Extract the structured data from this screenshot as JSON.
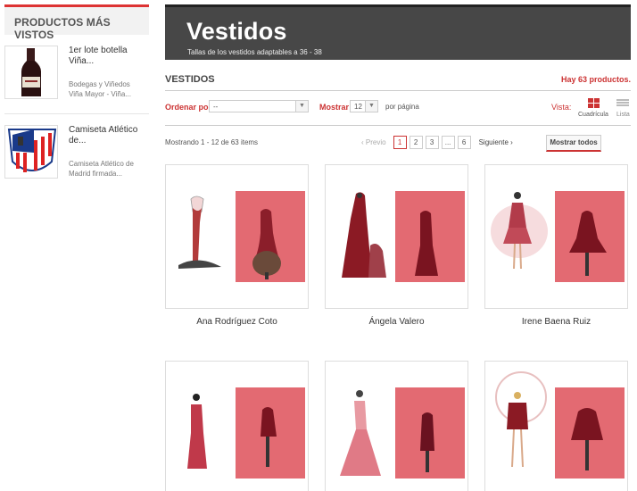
{
  "sidebar": {
    "heading": "PRODUCTOS MÁS VISTOS",
    "items": [
      {
        "title": "1er lote botella Viña...",
        "desc": "Bodegas y Viñedos Viña Mayor - Viña..."
      },
      {
        "title": "Camiseta Atlético de...",
        "desc": "Camiseta Atlético de Madrid firmada..."
      }
    ]
  },
  "banner": {
    "title": "Vestidos",
    "subtitle": "Tallas de los vestidos adaptables a 36 - 38"
  },
  "category": {
    "heading": "VESTIDOS",
    "count": "Hay 63 productos."
  },
  "toolbar": {
    "sort_label": "Ordenar por",
    "sort_value": "--",
    "show_label": "Mostrar",
    "show_value": "12",
    "per_page": "por página",
    "view_label": "Vista:",
    "view_grid": "Cuadrícula",
    "view_list": "Lista"
  },
  "pagination": {
    "showing": "Mostrando 1 - 12 de 63 items",
    "prev": "Previo",
    "pages": [
      "1",
      "2",
      "3",
      "...",
      "6"
    ],
    "next": "Siguiente",
    "show_all": "Mostrar todos"
  },
  "products": [
    {
      "name": "Ana Rodríguez Coto"
    },
    {
      "name": "Ángela Valero"
    },
    {
      "name": "Irene Baena Ruiz"
    },
    {
      "name": ""
    },
    {
      "name": ""
    },
    {
      "name": ""
    }
  ],
  "colors": {
    "accent": "#cc3333",
    "banner": "#474747"
  }
}
